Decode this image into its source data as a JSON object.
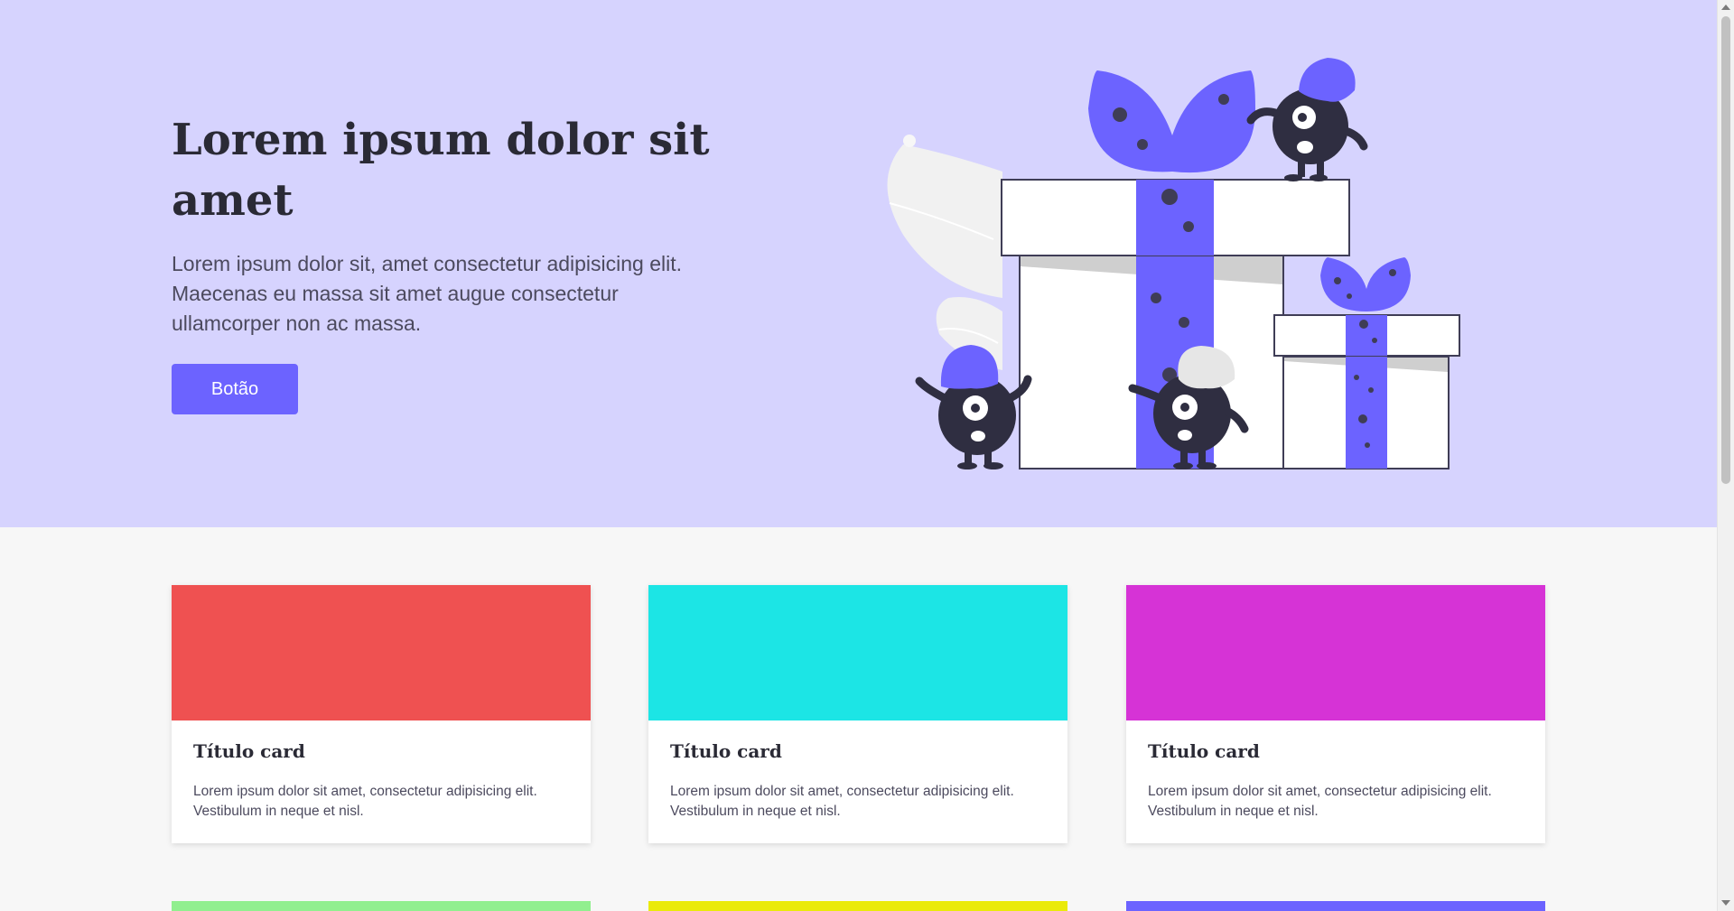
{
  "hero": {
    "title": "Lorem ipsum dolor sit amet",
    "text": "Lorem ipsum dolor sit, amet consectetur adipisicing elit. Maecenas eu massa sit amet augue consectetur ullamcorper non ac massa.",
    "button_label": "Botão",
    "background_color": "#d6d3fe",
    "accent_color": "#6c63ff",
    "illustration_icon": "gift-boxes-monsters-illustration"
  },
  "cards": [
    {
      "title": "Título card",
      "text": "Lorem ipsum dolor sit amet, consectetur adipisicing elit. Vestibulum in neque et nisl.",
      "color": "#ef5151"
    },
    {
      "title": "Título card",
      "text": "Lorem ipsum dolor sit amet, consectetur adipisicing elit. Vestibulum in neque et nisl.",
      "color": "#1ce5e5"
    },
    {
      "title": "Título card",
      "text": "Lorem ipsum dolor sit amet, consectetur adipisicing elit. Vestibulum in neque et nisl.",
      "color": "#d633d6"
    }
  ],
  "next_row_cards": [
    {
      "color": "#91ef8f"
    },
    {
      "color": "#eaea0a"
    },
    {
      "color": "#6c63ff"
    }
  ]
}
